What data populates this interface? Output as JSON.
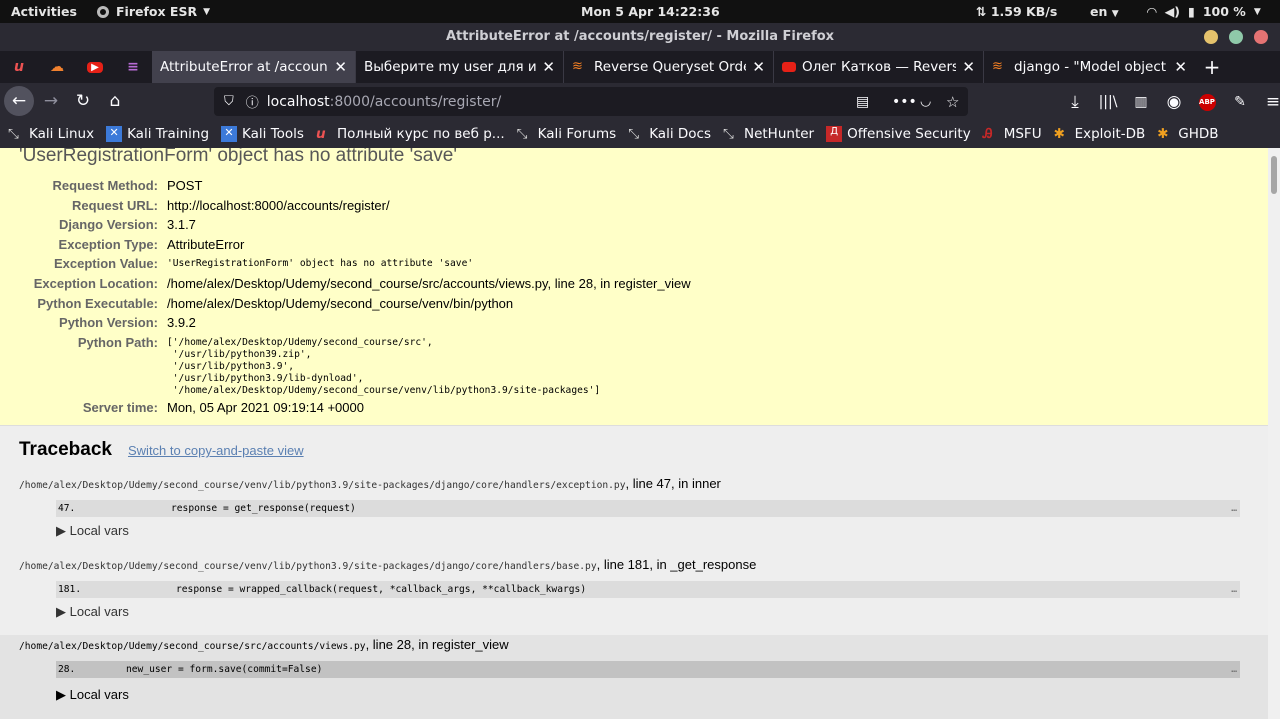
{
  "topbar": {
    "activities": "Activities",
    "app_name": "Firefox ESR",
    "clock": "Mon 5 Apr  14:22:36",
    "net_speed": "1.59 KB/s",
    "lang": "en",
    "battery": "100 %"
  },
  "window": {
    "title": "AttributeError at /accounts/register/ - Mozilla Firefox"
  },
  "tabs": [
    {
      "label": "AttributeError at /accounts/register/",
      "active": true
    },
    {
      "label": "Выберите my user для изменения",
      "active": false
    },
    {
      "label": "Reverse Queryset Order in Django",
      "active": false
    },
    {
      "label": "Олег Катков — Reverse",
      "active": false
    },
    {
      "label": "django - \"Model object has no attribute 'save'\"",
      "active": false
    }
  ],
  "urlbar": {
    "host": "localhost",
    "path": ":8000/accounts/register/"
  },
  "bookmarks": [
    "Kali Linux",
    "Kali Training",
    "Kali Tools",
    "Полный курс по веб р...",
    "Kali Forums",
    "Kali Docs",
    "NetHunter",
    "Offensive Security",
    "MSFU",
    "Exploit-DB",
    "GHDB"
  ],
  "error": {
    "heading": "'UserRegistrationForm' object has no attribute 'save'",
    "meta": [
      {
        "label": "Request Method:",
        "value": "POST"
      },
      {
        "label": "Request URL:",
        "value": "http://localhost:8000/accounts/register/"
      },
      {
        "label": "Django Version:",
        "value": "3.1.7"
      },
      {
        "label": "Exception Type:",
        "value": "AttributeError"
      },
      {
        "label": "Exception Value:",
        "value": "'UserRegistrationForm' object has no attribute 'save'"
      },
      {
        "label": "Exception Location:",
        "value": "/home/alex/Desktop/Udemy/second_course/src/accounts/views.py, line 28, in register_view"
      },
      {
        "label": "Python Executable:",
        "value": "/home/alex/Desktop/Udemy/second_course/venv/bin/python"
      },
      {
        "label": "Python Version:",
        "value": "3.9.2"
      },
      {
        "label": "Python Path:",
        "value": "['/home/alex/Desktop/Udemy/second_course/src',\n '/usr/lib/python39.zip',\n '/usr/lib/python3.9',\n '/usr/lib/python3.9/lib-dynload',\n '/home/alex/Desktop/Udemy/second_course/venv/lib/python3.9/site-packages']"
      },
      {
        "label": "Server time:",
        "value": "Mon, 05 Apr 2021 09:19:14 +0000"
      }
    ]
  },
  "traceback": {
    "title": "Traceback",
    "switch_link": "Switch to copy-and-paste view",
    "local_vars": "▶ Local vars",
    "ellipsis": "…",
    "frames": [
      {
        "file": "/home/alex/Desktop/Udemy/second_course/venv/lib/python3.9/site-packages/django/core/handlers/exception.py",
        "loc": ", line 47, in inner",
        "lineno": "47.",
        "code": "response = get_response(request)"
      },
      {
        "file": "/home/alex/Desktop/Udemy/second_course/venv/lib/python3.9/site-packages/django/core/handlers/base.py",
        "loc": ", line 181, in _get_response",
        "lineno": "181.",
        "code": "response = wrapped_callback(request, *callback_args, **callback_kwargs)"
      },
      {
        "file": "/home/alex/Desktop/Udemy/second_course/src/accounts/views.py",
        "loc": ", line 28, in register_view",
        "lineno": "28.",
        "code": "new_user = form.save(commit=False)"
      }
    ]
  }
}
